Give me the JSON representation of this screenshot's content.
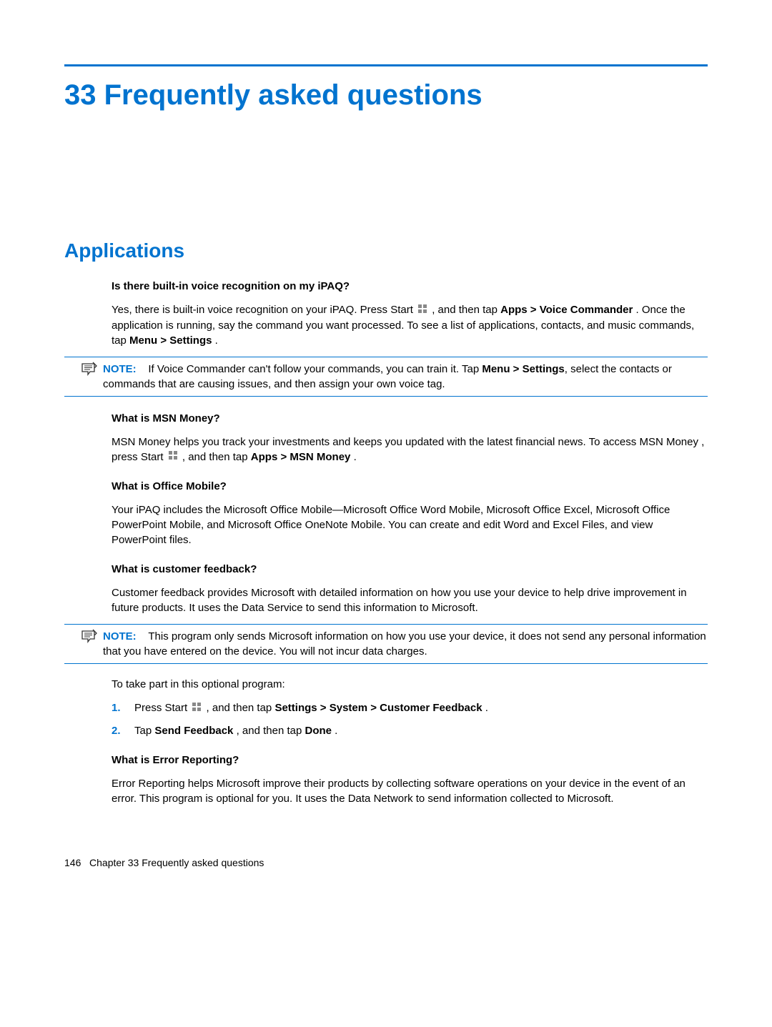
{
  "chapter": {
    "number": "33",
    "title_full": "33  Frequently asked questions"
  },
  "sections": {
    "applications_title": "Applications",
    "q1": {
      "question": "Is there built-in voice recognition on my iPAQ?",
      "a1_pre": "Yes, there is built-in voice recognition on your iPAQ. Press Start ",
      "a1_mid": ", and then tap ",
      "a1_bold1": "Apps > Voice Commander",
      "a1_post": ". Once the application is running, say the command you want processed. To see a list of applications, contacts, and music commands, tap ",
      "a1_bold2": "Menu > Settings",
      "a1_end": ".",
      "note_label": "NOTE:",
      "note_pre": "If Voice Commander can't follow your commands, you can train it. Tap ",
      "note_bold": "Menu > Settings",
      "note_post": ", select the contacts or commands that are causing issues, and then assign your own voice tag."
    },
    "q2": {
      "question": "What is MSN Money?",
      "a_pre": "MSN Money helps you track your investments and keeps you updated with the latest financial news. To access MSN Money , press Start ",
      "a_mid": ", and then tap ",
      "a_bold": "Apps > MSN Money",
      "a_end": "."
    },
    "q3": {
      "question": "What is Office Mobile?",
      "answer": "Your iPAQ includes the Microsoft Office Mobile—Microsoft Office Word Mobile, Microsoft Office Excel, Microsoft Office PowerPoint Mobile, and Microsoft Office OneNote Mobile. You can create and edit Word and Excel Files, and view PowerPoint files."
    },
    "q4": {
      "question": "What is customer feedback?",
      "answer": "Customer feedback provides Microsoft with detailed information on how you use your device to help drive improvement in future products. It uses the Data Service to send this information to Microsoft.",
      "note_label": "NOTE:",
      "note_text": "This program only sends Microsoft information on how you use your device, it does not send any personal information that you have entered on the device. You will not incur data charges.",
      "steps_intro": "To take part in this optional program:",
      "step1_num": "1.",
      "step1_pre": "Press Start ",
      "step1_mid": ", and then tap ",
      "step1_bold": "Settings > System > Customer Feedback",
      "step1_end": ".",
      "step2_num": "2.",
      "step2_pre": "Tap ",
      "step2_bold1": "Send Feedback",
      "step2_mid": ", and then tap ",
      "step2_bold2": "Done",
      "step2_end": "."
    },
    "q5": {
      "question": "What is Error Reporting?",
      "answer": "Error Reporting helps Microsoft improve their products by collecting software operations on your device in the event of an error. This program is optional for you. It uses the Data Network to send information collected to Microsoft."
    }
  },
  "footer": {
    "page": "146",
    "chapter_label": "Chapter 33   Frequently asked questions"
  }
}
